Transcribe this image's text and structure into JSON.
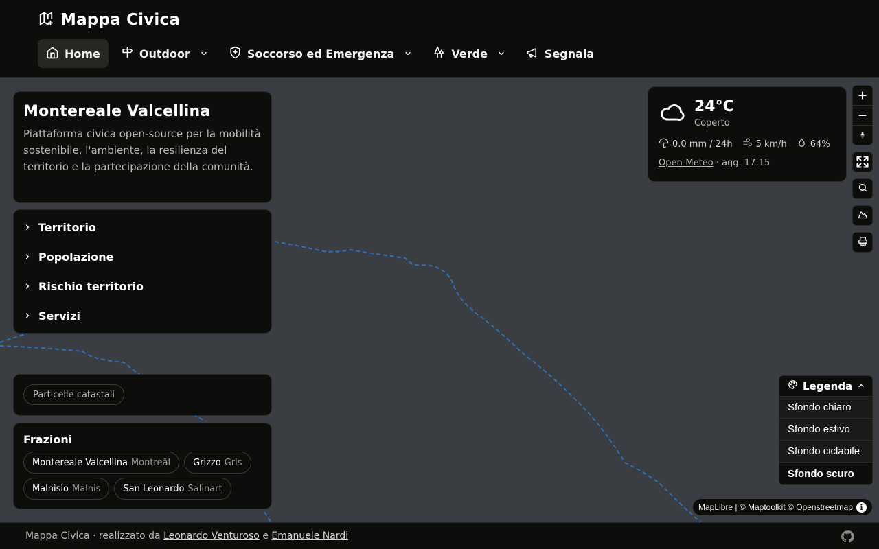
{
  "app": {
    "title": "Mappa Civica"
  },
  "nav": {
    "items": [
      {
        "label": "Home",
        "icon": "home-icon",
        "active": true,
        "dropdown": false
      },
      {
        "label": "Outdoor",
        "icon": "signpost-icon",
        "active": false,
        "dropdown": true
      },
      {
        "label": "Soccorso ed Emergenza",
        "icon": "shield-plus-icon",
        "active": false,
        "dropdown": true
      },
      {
        "label": "Verde",
        "icon": "trees-icon",
        "active": false,
        "dropdown": true
      },
      {
        "label": "Segnala",
        "icon": "megaphone-icon",
        "active": false,
        "dropdown": false
      }
    ]
  },
  "intro": {
    "title": "Montereale Valcellina",
    "description": "Piattaforma civica open-source per la mobilità sostenibile, l'ambiente, la resilienza del territorio e la partecipazione della comunità."
  },
  "accordion": {
    "items": [
      "Territorio",
      "Popolazione",
      "Rischio territorio",
      "Servizi"
    ]
  },
  "layers": {
    "chip": "Particelle catastali"
  },
  "frazioni": {
    "title": "Frazioni",
    "items": [
      {
        "name": "Montereale Valcellina",
        "friulian": "Montreâl"
      },
      {
        "name": "Grizzo",
        "friulian": "Gris"
      },
      {
        "name": "Malnisio",
        "friulian": "Malnis"
      },
      {
        "name": "San Leonardo",
        "friulian": "Salinart"
      }
    ]
  },
  "weather": {
    "temperature": "24°C",
    "condition": "Coperto",
    "precipitation": "0.0 mm / 24h",
    "wind": "5 km/h",
    "humidity": "64%",
    "source_link": "Open-Meteo",
    "updated": "· agg. 17:15"
  },
  "legend": {
    "title": "Legenda",
    "options": [
      {
        "label": "Sfondo chiaro",
        "selected": false
      },
      {
        "label": "Sfondo estivo",
        "selected": false
      },
      {
        "label": "Sfondo ciclabile",
        "selected": false
      },
      {
        "label": "Sfondo scuro",
        "selected": true
      }
    ]
  },
  "attribution": {
    "text": "MapLibre | © Maptoolkit © Openstreetmap"
  },
  "footer": {
    "prefix": "Mappa Civica · realizzato da",
    "author1": "Leonardo Venturoso",
    "conj": "e",
    "author2": "Emanuele Nardi"
  },
  "colors": {
    "header_bg": "#0d0d0b",
    "map_bg": "#3a3d42",
    "boundary": "#2e6fb8"
  }
}
